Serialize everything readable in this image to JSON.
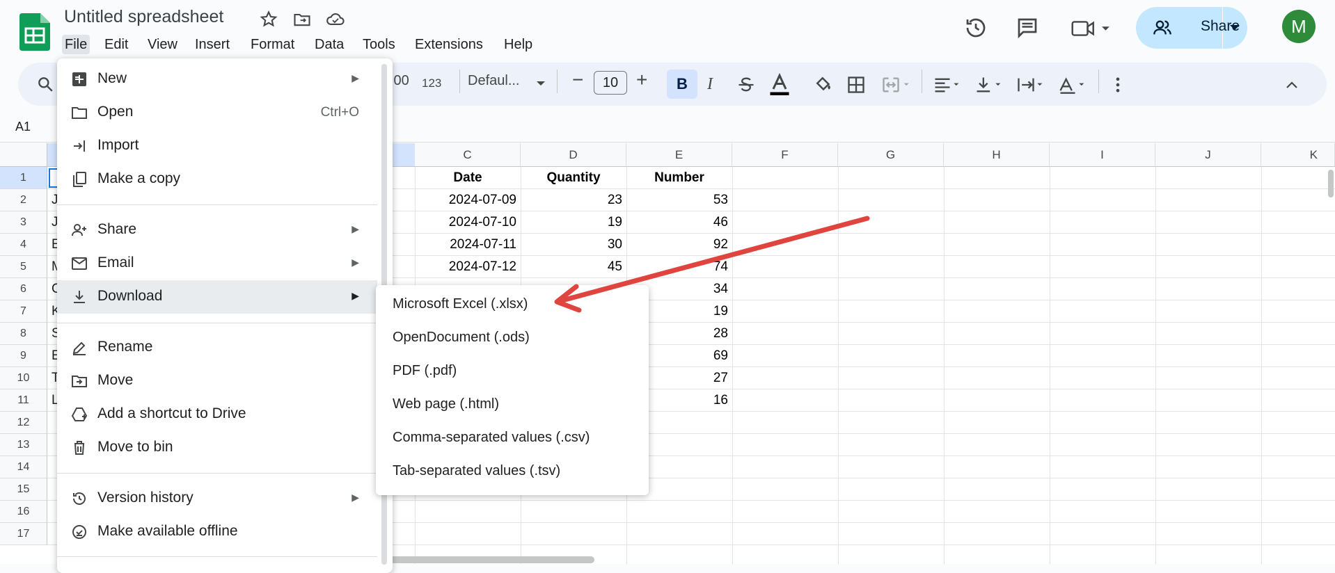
{
  "title_bar": {
    "doc_title": "Untitled spreadsheet",
    "menus": [
      "File",
      "Edit",
      "View",
      "Insert",
      "Format",
      "Data",
      "Tools",
      "Extensions",
      "Help"
    ],
    "share_label": "Share",
    "avatar_initial": "M"
  },
  "toolbar": {
    "format_number": ".00",
    "format_123": "123",
    "font_name": "Defaul...",
    "font_size": "10",
    "bold": "B",
    "italic": "I"
  },
  "formula_bar": {
    "cell_ref": "A1"
  },
  "columns": [
    "C",
    "D",
    "E",
    "F",
    "G",
    "H",
    "I",
    "J",
    "K"
  ],
  "rows": [
    "1",
    "2",
    "3",
    "4",
    "5",
    "6",
    "7",
    "8",
    "9",
    "10",
    "11",
    "12",
    "13",
    "14",
    "15",
    "16",
    "17"
  ],
  "row_col_a_partial": [
    "J",
    "J",
    "E",
    "M",
    "C",
    "K",
    "S",
    "E",
    "T",
    "L"
  ],
  "table": {
    "headers": {
      "C": "Date",
      "D": "Quantity",
      "E": "Number"
    },
    "rows": [
      {
        "C": "2024-07-09",
        "D": "23",
        "E": "53"
      },
      {
        "C": "2024-07-10",
        "D": "19",
        "E": "46"
      },
      {
        "C": "2024-07-11",
        "D": "30",
        "E": "92"
      },
      {
        "C": "2024-07-12",
        "D": "45",
        "E": "74"
      },
      {
        "C": "",
        "D": "",
        "E": "34"
      },
      {
        "C": "",
        "D": "",
        "E": "19"
      },
      {
        "C": "",
        "D": "",
        "E": "28"
      },
      {
        "C": "",
        "D": "",
        "E": "69"
      },
      {
        "C": "",
        "D": "",
        "E": "27"
      },
      {
        "C": "",
        "D": "",
        "E": "16"
      }
    ]
  },
  "file_menu": {
    "new": "New",
    "open": "Open",
    "open_shortcut": "Ctrl+O",
    "import": "Import",
    "make_copy": "Make a copy",
    "share": "Share",
    "email": "Email",
    "download": "Download",
    "rename": "Rename",
    "move": "Move",
    "add_shortcut": "Add a shortcut to Drive",
    "move_to_bin": "Move to bin",
    "version_history": "Version history",
    "offline": "Make available offline"
  },
  "download_menu": {
    "xlsx": "Microsoft Excel (.xlsx)",
    "ods": "OpenDocument (.ods)",
    "pdf": "PDF (.pdf)",
    "html": "Web page (.html)",
    "csv": "Comma-separated values (.csv)",
    "tsv": "Tab-separated values (.tsv)"
  },
  "colors": {
    "annotation_arrow": "#e0443e",
    "share_button": "#c2e7ff",
    "toolbar_bg": "#edf2fa",
    "sheets_green": "#0f9d58"
  }
}
